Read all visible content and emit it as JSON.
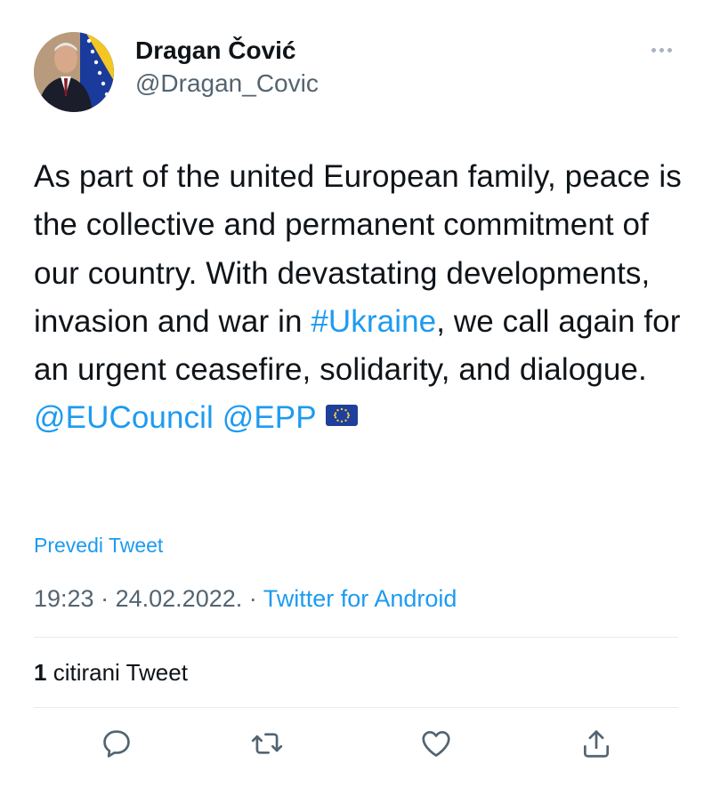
{
  "author": {
    "name": "Dragan Čović",
    "handle": "@Dragan_Covic",
    "avatar_icon": "profile-photo-with-bosnia-flag"
  },
  "more_icon": "more-options-icon",
  "tweet": {
    "text_before": "As part of the united European family, peace is the collective and permanent commitment of our country. With devastating developments, invasion and war in ",
    "hashtag": "#Ukraine",
    "text_after": ", we call again for an urgent ceasefire, solidarity, and dialogue. ",
    "mention1": "@EUCouncil",
    "mention2": "@EPP",
    "emoji": "eu-flag"
  },
  "translate_label": "Prevedi Tweet",
  "meta": {
    "time": "19:23",
    "date": "24.02.2022.",
    "separator": "·",
    "source": "Twitter for Android"
  },
  "quotes": {
    "count": "1",
    "label": "citirani Tweet"
  },
  "actions": [
    "reply-icon",
    "retweet-icon",
    "like-icon",
    "share-icon"
  ],
  "colors": {
    "link": "#1d9bf0",
    "text": "#0f1419",
    "secondary": "#536471",
    "divider": "#e6ecf0"
  }
}
